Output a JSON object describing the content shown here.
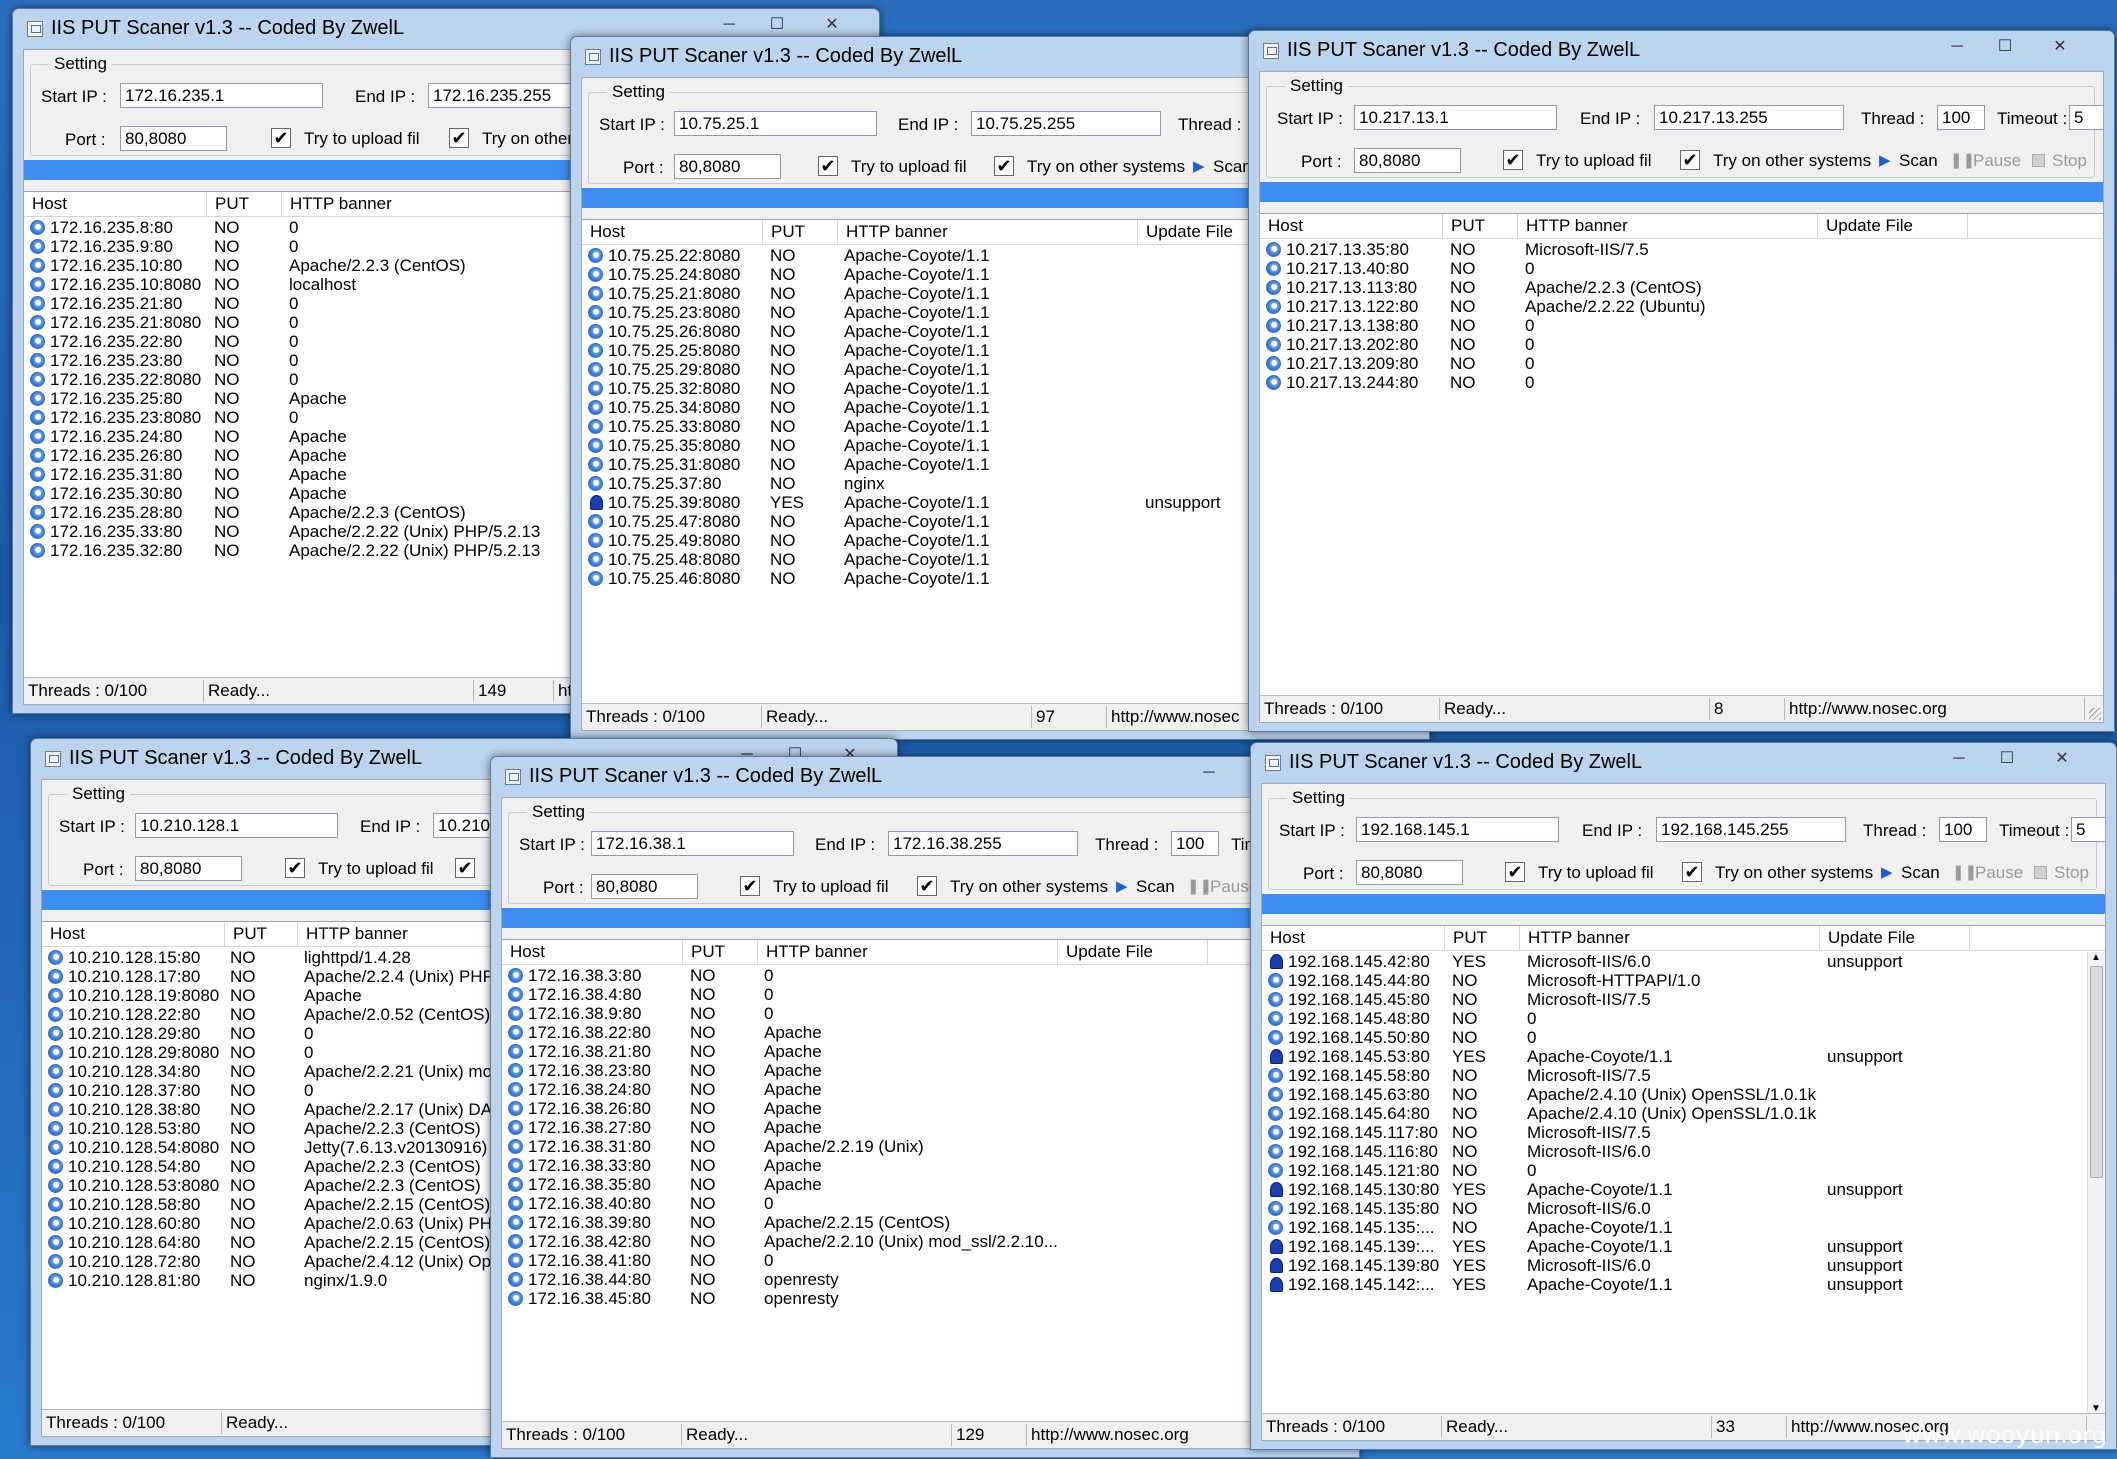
{
  "watermark": "www.wooyun.org",
  "common": {
    "title": "IIS PUT Scaner v1.3 -- Coded By ZwelL",
    "setting": "Setting",
    "start_ip_label": "Start IP :",
    "end_ip_label": "End IP :",
    "port_label": "Port :",
    "thread_label": "Thread :",
    "timeout_label": "Timeout :",
    "try_upload": "Try to upload fil",
    "try_other": "Try on other systems",
    "try_other_cut": "Try on other sy",
    "scan": "Scan",
    "pause": "Pause",
    "stop": "Stop",
    "col_host": "Host",
    "col_put": "PUT",
    "col_banner": "HTTP banner",
    "col_update": "Update File",
    "threads": "Threads : 0/100",
    "ready": "Ready...",
    "url": "http://www.nosec.org",
    "url_cut1": "http://www.nosec",
    "url_cut2": "ht"
  },
  "w1": {
    "start": "172.16.235.1",
    "end": "172.16.235.255",
    "port": "80,8080",
    "count": "149",
    "rows": [
      [
        "172.16.235.8:80",
        "NO",
        "0"
      ],
      [
        "172.16.235.9:80",
        "NO",
        "0"
      ],
      [
        "172.16.235.10:80",
        "NO",
        "Apache/2.2.3 (CentOS)"
      ],
      [
        "172.16.235.10:8080",
        "NO",
        "localhost"
      ],
      [
        "172.16.235.21:80",
        "NO",
        "0"
      ],
      [
        "172.16.235.21:8080",
        "NO",
        "0"
      ],
      [
        "172.16.235.22:80",
        "NO",
        "0"
      ],
      [
        "172.16.235.23:80",
        "NO",
        "0"
      ],
      [
        "172.16.235.22:8080",
        "NO",
        "0"
      ],
      [
        "172.16.235.25:80",
        "NO",
        "Apache"
      ],
      [
        "172.16.235.23:8080",
        "NO",
        "0"
      ],
      [
        "172.16.235.24:80",
        "NO",
        "Apache"
      ],
      [
        "172.16.235.26:80",
        "NO",
        "Apache"
      ],
      [
        "172.16.235.31:80",
        "NO",
        "Apache"
      ],
      [
        "172.16.235.30:80",
        "NO",
        "Apache"
      ],
      [
        "172.16.235.28:80",
        "NO",
        "Apache/2.2.3 (CentOS)"
      ],
      [
        "172.16.235.33:80",
        "NO",
        "Apache/2.2.22 (Unix) PHP/5.2.13"
      ],
      [
        "172.16.235.32:80",
        "NO",
        "Apache/2.2.22 (Unix) PHP/5.2.13"
      ]
    ]
  },
  "w2": {
    "start": "10.75.25.1",
    "end": "10.75.25.255",
    "port": "80,8080",
    "count": "97",
    "rows": [
      [
        "10.75.25.22:8080",
        "NO",
        "Apache-Coyote/1.1",
        ""
      ],
      [
        "10.75.25.24:8080",
        "NO",
        "Apache-Coyote/1.1",
        ""
      ],
      [
        "10.75.25.21:8080",
        "NO",
        "Apache-Coyote/1.1",
        ""
      ],
      [
        "10.75.25.23:8080",
        "NO",
        "Apache-Coyote/1.1",
        ""
      ],
      [
        "10.75.25.26:8080",
        "NO",
        "Apache-Coyote/1.1",
        ""
      ],
      [
        "10.75.25.25:8080",
        "NO",
        "Apache-Coyote/1.1",
        ""
      ],
      [
        "10.75.25.29:8080",
        "NO",
        "Apache-Coyote/1.1",
        ""
      ],
      [
        "10.75.25.32:8080",
        "NO",
        "Apache-Coyote/1.1",
        ""
      ],
      [
        "10.75.25.34:8080",
        "NO",
        "Apache-Coyote/1.1",
        ""
      ],
      [
        "10.75.25.33:8080",
        "NO",
        "Apache-Coyote/1.1",
        ""
      ],
      [
        "10.75.25.35:8080",
        "NO",
        "Apache-Coyote/1.1",
        ""
      ],
      [
        "10.75.25.31:8080",
        "NO",
        "Apache-Coyote/1.1",
        ""
      ],
      [
        "10.75.25.37:80",
        "NO",
        "nginx",
        ""
      ],
      [
        "10.75.25.39:8080",
        "YES",
        "Apache-Coyote/1.1",
        "unsupport"
      ],
      [
        "10.75.25.47:8080",
        "NO",
        "Apache-Coyote/1.1",
        ""
      ],
      [
        "10.75.25.49:8080",
        "NO",
        "Apache-Coyote/1.1",
        ""
      ],
      [
        "10.75.25.48:8080",
        "NO",
        "Apache-Coyote/1.1",
        ""
      ],
      [
        "10.75.25.46:8080",
        "NO",
        "Apache-Coyote/1.1",
        ""
      ]
    ]
  },
  "w3": {
    "start": "10.217.13.1",
    "end": "10.217.13.255",
    "port": "80,8080",
    "thread": "100",
    "timeout": "5",
    "count": "8",
    "rows": [
      [
        "10.217.13.35:80",
        "NO",
        "Microsoft-IIS/7.5",
        ""
      ],
      [
        "10.217.13.40:80",
        "NO",
        "0",
        ""
      ],
      [
        "10.217.13.113:80",
        "NO",
        "Apache/2.2.3 (CentOS)",
        ""
      ],
      [
        "10.217.13.122:80",
        "NO",
        "Apache/2.2.22 (Ubuntu)",
        ""
      ],
      [
        "10.217.13.138:80",
        "NO",
        "0",
        ""
      ],
      [
        "10.217.13.202:80",
        "NO",
        "0",
        ""
      ],
      [
        "10.217.13.209:80",
        "NO",
        "0",
        ""
      ],
      [
        "10.217.13.244:80",
        "NO",
        "0",
        ""
      ]
    ]
  },
  "w4": {
    "start": "10.210.128.1",
    "end": "10.210.1",
    "port": "80,8080",
    "rows": [
      [
        "10.210.128.15:80",
        "NO",
        "lighttpd/1.4.28"
      ],
      [
        "10.210.128.17:80",
        "NO",
        "Apache/2.2.4 (Unix) PHP"
      ],
      [
        "10.210.128.19:8080",
        "NO",
        "Apache"
      ],
      [
        "10.210.128.22:80",
        "NO",
        "Apache/2.0.52 (CentOS)"
      ],
      [
        "10.210.128.29:80",
        "NO",
        "0"
      ],
      [
        "10.210.128.29:8080",
        "NO",
        "0"
      ],
      [
        "10.210.128.34:80",
        "NO",
        "Apache/2.2.21 (Unix) mo"
      ],
      [
        "10.210.128.37:80",
        "NO",
        "0"
      ],
      [
        "10.210.128.38:80",
        "NO",
        "Apache/2.2.17 (Unix) DA"
      ],
      [
        "10.210.128.53:80",
        "NO",
        "Apache/2.2.3 (CentOS)"
      ],
      [
        "10.210.128.54:8080",
        "NO",
        "Jetty(7.6.13.v20130916)"
      ],
      [
        "10.210.128.54:80",
        "NO",
        "Apache/2.2.3 (CentOS)"
      ],
      [
        "10.210.128.53:8080",
        "NO",
        "Apache/2.2.3 (CentOS)"
      ],
      [
        "10.210.128.58:80",
        "NO",
        "Apache/2.2.15 (CentOS)"
      ],
      [
        "10.210.128.60:80",
        "NO",
        "Apache/2.0.63 (Unix) PH"
      ],
      [
        "10.210.128.64:80",
        "NO",
        "Apache/2.2.15 (CentOS)"
      ],
      [
        "10.210.128.72:80",
        "NO",
        "Apache/2.4.12 (Unix) Op"
      ],
      [
        "10.210.128.81:80",
        "NO",
        "nginx/1.9.0"
      ]
    ]
  },
  "w5": {
    "start": "172.16.38.1",
    "end": "172.16.38.255",
    "port": "80,8080",
    "thread": "100",
    "timeout_cut": "Tim",
    "count": "129",
    "rows": [
      [
        "172.16.38.3:80",
        "NO",
        "0",
        ""
      ],
      [
        "172.16.38.4:80",
        "NO",
        "0",
        ""
      ],
      [
        "172.16.38.9:80",
        "NO",
        "0",
        ""
      ],
      [
        "172.16.38.22:80",
        "NO",
        "Apache",
        ""
      ],
      [
        "172.16.38.21:80",
        "NO",
        "Apache",
        ""
      ],
      [
        "172.16.38.23:80",
        "NO",
        "Apache",
        ""
      ],
      [
        "172.16.38.24:80",
        "NO",
        "Apache",
        ""
      ],
      [
        "172.16.38.26:80",
        "NO",
        "Apache",
        ""
      ],
      [
        "172.16.38.27:80",
        "NO",
        "Apache",
        ""
      ],
      [
        "172.16.38.31:80",
        "NO",
        "Apache/2.2.19 (Unix)",
        ""
      ],
      [
        "172.16.38.33:80",
        "NO",
        "Apache",
        ""
      ],
      [
        "172.16.38.35:80",
        "NO",
        "Apache",
        ""
      ],
      [
        "172.16.38.40:80",
        "NO",
        "0",
        ""
      ],
      [
        "172.16.38.39:80",
        "NO",
        "Apache/2.2.15 (CentOS)",
        ""
      ],
      [
        "172.16.38.42:80",
        "NO",
        "Apache/2.2.10 (Unix) mod_ssl/2.2.10...",
        ""
      ],
      [
        "172.16.38.41:80",
        "NO",
        "0",
        ""
      ],
      [
        "172.16.38.44:80",
        "NO",
        "openresty",
        ""
      ],
      [
        "172.16.38.45:80",
        "NO",
        "openresty",
        ""
      ]
    ]
  },
  "w6": {
    "start": "192.168.145.1",
    "end": "192.168.145.255",
    "port": "80,8080",
    "thread": "100",
    "timeout": "5",
    "count": "33",
    "rows": [
      [
        "192.168.145.42:80",
        "YES",
        "Microsoft-IIS/6.0",
        "unsupport"
      ],
      [
        "192.168.145.44:80",
        "NO",
        "Microsoft-HTTPAPI/1.0",
        ""
      ],
      [
        "192.168.145.45:80",
        "NO",
        "Microsoft-IIS/7.5",
        ""
      ],
      [
        "192.168.145.48:80",
        "NO",
        "0",
        ""
      ],
      [
        "192.168.145.50:80",
        "NO",
        "0",
        ""
      ],
      [
        "192.168.145.53:80",
        "YES",
        "Apache-Coyote/1.1",
        "unsupport"
      ],
      [
        "192.168.145.58:80",
        "NO",
        "Microsoft-IIS/7.5",
        ""
      ],
      [
        "192.168.145.63:80",
        "NO",
        "Apache/2.4.10 (Unix) OpenSSL/1.0.1k",
        ""
      ],
      [
        "192.168.145.64:80",
        "NO",
        "Apache/2.4.10 (Unix) OpenSSL/1.0.1k",
        ""
      ],
      [
        "192.168.145.117:80",
        "NO",
        "Microsoft-IIS/7.5",
        ""
      ],
      [
        "192.168.145.116:80",
        "NO",
        "Microsoft-IIS/6.0",
        ""
      ],
      [
        "192.168.145.121:80",
        "NO",
        "0",
        ""
      ],
      [
        "192.168.145.130:80",
        "YES",
        "Apache-Coyote/1.1",
        "unsupport"
      ],
      [
        "192.168.145.135:80",
        "NO",
        "Microsoft-IIS/6.0",
        ""
      ],
      [
        "192.168.145.135:...",
        "NO",
        "Apache-Coyote/1.1",
        ""
      ],
      [
        "192.168.145.139:...",
        "YES",
        "Apache-Coyote/1.1",
        "unsupport"
      ],
      [
        "192.168.145.139:80",
        "YES",
        "Microsoft-IIS/6.0",
        "unsupport"
      ],
      [
        "192.168.145.142:...",
        "YES",
        "Apache-Coyote/1.1",
        "unsupport"
      ]
    ]
  }
}
